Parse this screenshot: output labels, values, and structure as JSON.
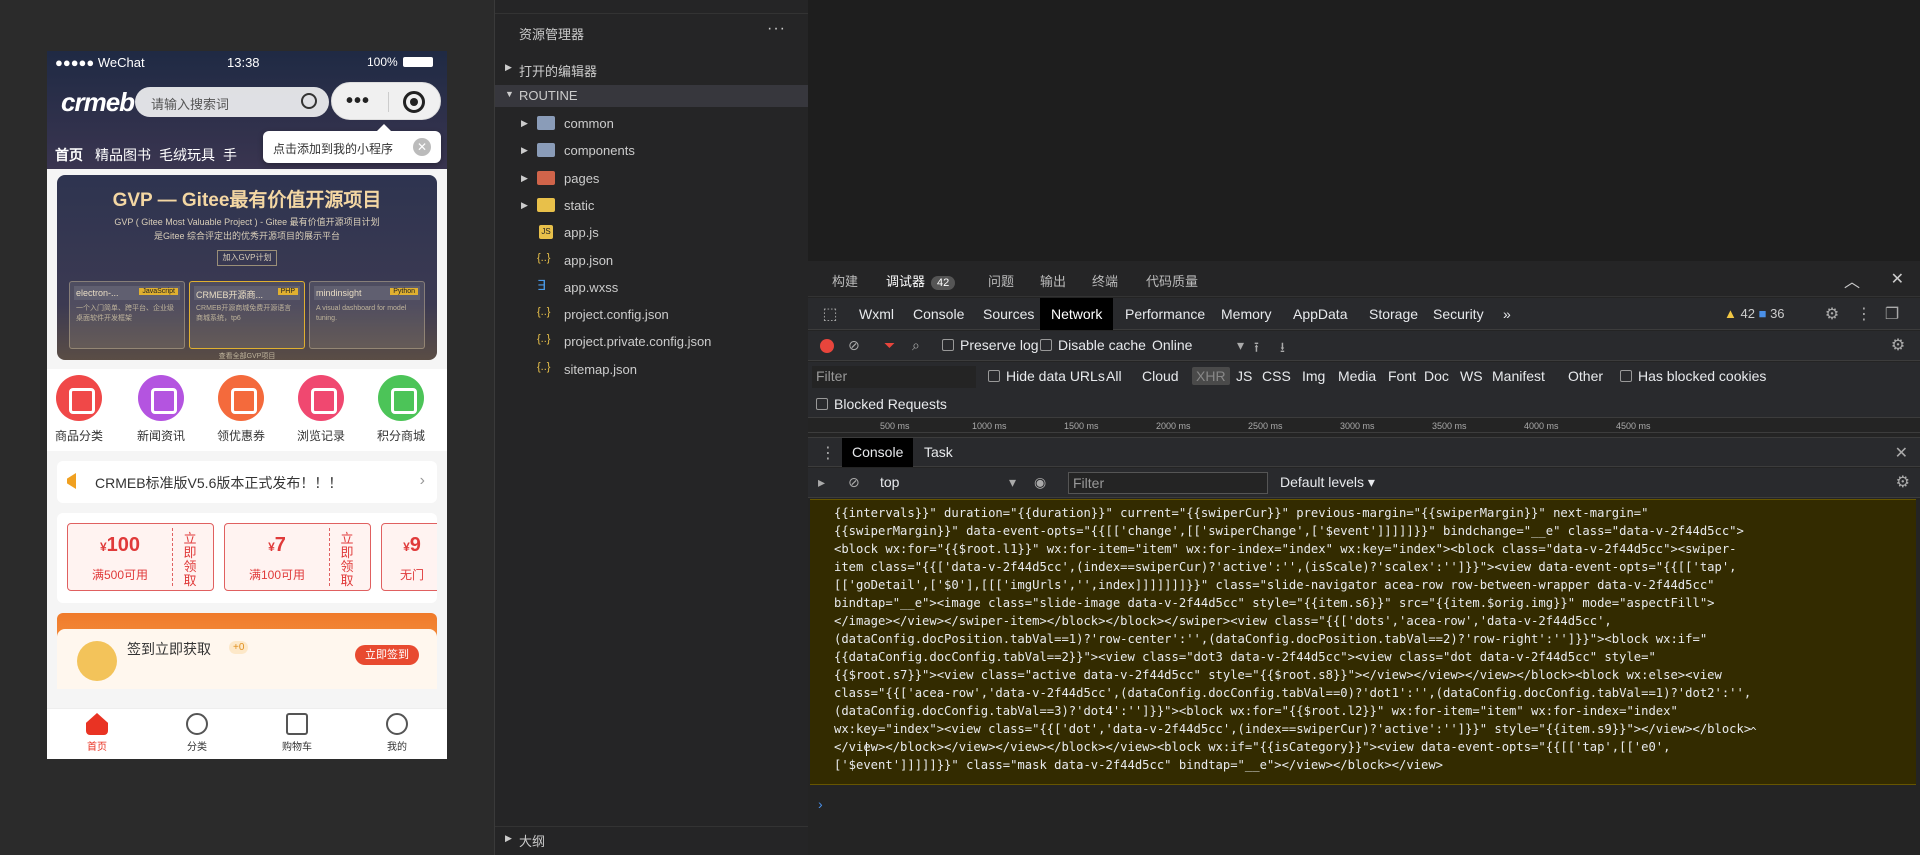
{
  "simulator": {
    "status": {
      "carrier": "●●●●● WeChat",
      "time": "13:38",
      "battery": "100%"
    },
    "logo": "crmeb",
    "search_placeholder": "请输入搜索词",
    "tabs": [
      "首页",
      "精品图书",
      "毛绒玩具",
      "手"
    ],
    "tooltip": "点击添加到我的小程序",
    "banner": {
      "title": "GVP — Gitee最有价值开源项目",
      "sub1": "GVP ( Gitee Most Valuable Project ) - Gitee 最有价值开源项目计划",
      "sub2": "是Gitee 综合评定出的优秀开源项目的展示平台",
      "button": "加入GVP计划",
      "cards": [
        {
          "name": "electron-...",
          "tag": "JavaScript",
          "desc": "一个入门简单、跨平台、企业级桌面软件开发框架"
        },
        {
          "name": "CRMEB开源商...",
          "tag": "PHP",
          "desc": "CRMEB开源商城免费开源语言商城系统，tp6"
        },
        {
          "name": "mindinsight",
          "tag": "Python",
          "desc": "A visual dashboard for model tuning."
        }
      ],
      "footer": "查看全部GVP项目"
    },
    "icons": [
      {
        "label": "商品分类",
        "color": "#f04848"
      },
      {
        "label": "新闻资讯",
        "color": "#b454e0"
      },
      {
        "label": "领优惠券",
        "color": "#f46a3c"
      },
      {
        "label": "浏览记录",
        "color": "#f04870"
      },
      {
        "label": "积分商城",
        "color": "#4cc458"
      }
    ],
    "notice": "CRMEB标准版V5.6版本正式发布！！！",
    "coupons": [
      {
        "value": "100",
        "cond": "满500可用",
        "get": "立即领取"
      },
      {
        "value": "7",
        "cond": "满100可用",
        "get": "立即领取"
      },
      {
        "value": "9",
        "cond": "无门",
        "get": ""
      }
    ],
    "currency": "¥",
    "signin": {
      "text": "签到立即获取",
      "points": "+0",
      "button": "立即签到"
    },
    "tabbar": [
      "首页",
      "分类",
      "购物车",
      "我的"
    ]
  },
  "explorer": {
    "title": "资源管理器",
    "open_editors": "打开的编辑器",
    "root": "ROUTINE",
    "items": [
      {
        "name": "common",
        "kind": "folder"
      },
      {
        "name": "components",
        "kind": "folder"
      },
      {
        "name": "pages",
        "kind": "folder-r"
      },
      {
        "name": "static",
        "kind": "folder-y"
      },
      {
        "name": "app.js",
        "kind": "js"
      },
      {
        "name": "app.json",
        "kind": "json"
      },
      {
        "name": "app.wxss",
        "kind": "css"
      },
      {
        "name": "project.config.json",
        "kind": "json"
      },
      {
        "name": "project.private.config.json",
        "kind": "json"
      },
      {
        "name": "sitemap.json",
        "kind": "json"
      }
    ],
    "outline": "大纲"
  },
  "panel": {
    "tabs": [
      "构建",
      "调试器",
      "问题",
      "输出",
      "终端",
      "代码质量"
    ],
    "debugger_badge": "42"
  },
  "devtools": {
    "tabs": [
      "Wxml",
      "Console",
      "Sources",
      "Network",
      "Performance",
      "Memory",
      "AppData",
      "Storage",
      "Security"
    ],
    "more": "»",
    "warnings": "42",
    "messages": "36",
    "preserve_log": "Preserve log",
    "disable_cache": "Disable cache",
    "throttle": "Online",
    "filter_placeholder": "Filter",
    "hide_data_urls": "Hide data URLs",
    "types": [
      "All",
      "Cloud",
      "XHR",
      "JS",
      "CSS",
      "Img",
      "Media",
      "Font",
      "Doc",
      "WS",
      "Manifest",
      "Other"
    ],
    "has_blocked_cookies": "Has blocked cookies",
    "blocked_requests": "Blocked Requests",
    "timeline": [
      "500 ms",
      "1000 ms",
      "1500 ms",
      "2000 ms",
      "2500 ms",
      "3000 ms",
      "3500 ms",
      "4000 ms",
      "4500 ms"
    ],
    "drawer_tabs": [
      "Console",
      "Task"
    ],
    "context": "top",
    "console_filter": "Filter",
    "levels": "Default levels ▾",
    "log": "{{intervals}}\" duration=\"{{duration}}\" current=\"{{swiperCur}}\" previous-margin=\"{{swiperMargin}}\" next-margin=\"\n{{swiperMargin}}\" data-event-opts=\"{{[['change',[['swiperChange',['$event']]]]]}}\" bindchange=\"__e\" class=\"data-v-2f44d5cc\">\n<block wx:for=\"{{$root.l1}}\" wx:for-item=\"item\" wx:for-index=\"index\" wx:key=\"index\"><block class=\"data-v-2f44d5cc\"><swiper-\nitem class=\"{{['data-v-2f44d5cc',(index==swiperCur)?'active':'',(isScale)?'scalex':'']}}\"><view data-event-opts=\"{{[['tap',\n[['goDetail',['$0'],[[['imgUrls','',index]]]]]]]}}\" class=\"slide-navigator acea-row row-between-wrapper data-v-2f44d5cc\"\nbindtap=\"__e\"><image class=\"slide-image data-v-2f44d5cc\" style=\"{{item.s6}}\" src=\"{{item.$orig.img}}\" mode=\"aspectFill\">\n</image></view></swiper-item></block></block></swiper><view class=\"{{['dots','acea-row','data-v-2f44d5cc',\n(dataConfig.docPosition.tabVal==1)?'row-center':'',(dataConfig.docPosition.tabVal==2)?'row-right':'']}}\"><block wx:if=\"\n{{dataConfig.docConfig.tabVal==2}}\"><view class=\"dot3 data-v-2f44d5cc\"><view class=\"dot data-v-2f44d5cc\" style=\"\n{{$root.s7}}\"><view class=\"active data-v-2f44d5cc\" style=\"{{$root.s8}}\"></view></view></view></block><block wx:else><view\nclass=\"{{['acea-row','data-v-2f44d5cc',(dataConfig.docConfig.tabVal==0)?'dot1':'',(dataConfig.docConfig.tabVal==1)?'dot2':'',\n(dataConfig.docConfig.tabVal==3)?'dot4':'']}}\"><block wx:for=\"{{$root.l2}}\" wx:for-item=\"item\" wx:for-index=\"index\"\nwx:key=\"index\"><view class=\"{{['dot','data-v-2f44d5cc',(index==swiperCur)?'active':'']}}\" style=\"{{item.s9}}\"></view></block>\n</view></block></view></view></block></view><block wx:if=\"{{isCategory}}\"><view data-event-opts=\"{{[['tap',[['e0',\n['$event']]]]]}}\" class=\"mask data-v-2f44d5cc\" bindtap=\"__e\"></view></block></view>",
    "caret": "^",
    "prompt": "›"
  }
}
